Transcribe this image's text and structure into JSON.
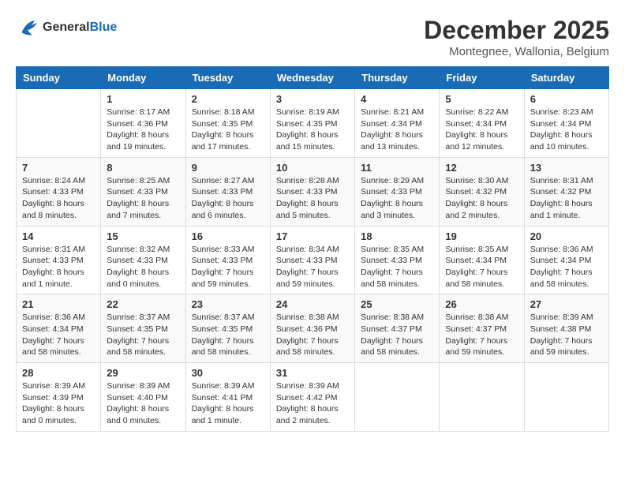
{
  "header": {
    "logo_line1": "General",
    "logo_line2": "Blue",
    "month_title": "December 2025",
    "location": "Montegnee, Wallonia, Belgium"
  },
  "days_of_week": [
    "Sunday",
    "Monday",
    "Tuesday",
    "Wednesday",
    "Thursday",
    "Friday",
    "Saturday"
  ],
  "weeks": [
    [
      {
        "day": "",
        "sunrise": "",
        "sunset": "",
        "daylight": ""
      },
      {
        "day": "1",
        "sunrise": "Sunrise: 8:17 AM",
        "sunset": "Sunset: 4:36 PM",
        "daylight": "Daylight: 8 hours and 19 minutes."
      },
      {
        "day": "2",
        "sunrise": "Sunrise: 8:18 AM",
        "sunset": "Sunset: 4:35 PM",
        "daylight": "Daylight: 8 hours and 17 minutes."
      },
      {
        "day": "3",
        "sunrise": "Sunrise: 8:19 AM",
        "sunset": "Sunset: 4:35 PM",
        "daylight": "Daylight: 8 hours and 15 minutes."
      },
      {
        "day": "4",
        "sunrise": "Sunrise: 8:21 AM",
        "sunset": "Sunset: 4:34 PM",
        "daylight": "Daylight: 8 hours and 13 minutes."
      },
      {
        "day": "5",
        "sunrise": "Sunrise: 8:22 AM",
        "sunset": "Sunset: 4:34 PM",
        "daylight": "Daylight: 8 hours and 12 minutes."
      },
      {
        "day": "6",
        "sunrise": "Sunrise: 8:23 AM",
        "sunset": "Sunset: 4:34 PM",
        "daylight": "Daylight: 8 hours and 10 minutes."
      }
    ],
    [
      {
        "day": "7",
        "sunrise": "Sunrise: 8:24 AM",
        "sunset": "Sunset: 4:33 PM",
        "daylight": "Daylight: 8 hours and 8 minutes."
      },
      {
        "day": "8",
        "sunrise": "Sunrise: 8:25 AM",
        "sunset": "Sunset: 4:33 PM",
        "daylight": "Daylight: 8 hours and 7 minutes."
      },
      {
        "day": "9",
        "sunrise": "Sunrise: 8:27 AM",
        "sunset": "Sunset: 4:33 PM",
        "daylight": "Daylight: 8 hours and 6 minutes."
      },
      {
        "day": "10",
        "sunrise": "Sunrise: 8:28 AM",
        "sunset": "Sunset: 4:33 PM",
        "daylight": "Daylight: 8 hours and 5 minutes."
      },
      {
        "day": "11",
        "sunrise": "Sunrise: 8:29 AM",
        "sunset": "Sunset: 4:33 PM",
        "daylight": "Daylight: 8 hours and 3 minutes."
      },
      {
        "day": "12",
        "sunrise": "Sunrise: 8:30 AM",
        "sunset": "Sunset: 4:32 PM",
        "daylight": "Daylight: 8 hours and 2 minutes."
      },
      {
        "day": "13",
        "sunrise": "Sunrise: 8:31 AM",
        "sunset": "Sunset: 4:32 PM",
        "daylight": "Daylight: 8 hours and 1 minute."
      }
    ],
    [
      {
        "day": "14",
        "sunrise": "Sunrise: 8:31 AM",
        "sunset": "Sunset: 4:33 PM",
        "daylight": "Daylight: 8 hours and 1 minute."
      },
      {
        "day": "15",
        "sunrise": "Sunrise: 8:32 AM",
        "sunset": "Sunset: 4:33 PM",
        "daylight": "Daylight: 8 hours and 0 minutes."
      },
      {
        "day": "16",
        "sunrise": "Sunrise: 8:33 AM",
        "sunset": "Sunset: 4:33 PM",
        "daylight": "Daylight: 7 hours and 59 minutes."
      },
      {
        "day": "17",
        "sunrise": "Sunrise: 8:34 AM",
        "sunset": "Sunset: 4:33 PM",
        "daylight": "Daylight: 7 hours and 59 minutes."
      },
      {
        "day": "18",
        "sunrise": "Sunrise: 8:35 AM",
        "sunset": "Sunset: 4:33 PM",
        "daylight": "Daylight: 7 hours and 58 minutes."
      },
      {
        "day": "19",
        "sunrise": "Sunrise: 8:35 AM",
        "sunset": "Sunset: 4:34 PM",
        "daylight": "Daylight: 7 hours and 58 minutes."
      },
      {
        "day": "20",
        "sunrise": "Sunrise: 8:36 AM",
        "sunset": "Sunset: 4:34 PM",
        "daylight": "Daylight: 7 hours and 58 minutes."
      }
    ],
    [
      {
        "day": "21",
        "sunrise": "Sunrise: 8:36 AM",
        "sunset": "Sunset: 4:34 PM",
        "daylight": "Daylight: 7 hours and 58 minutes."
      },
      {
        "day": "22",
        "sunrise": "Sunrise: 8:37 AM",
        "sunset": "Sunset: 4:35 PM",
        "daylight": "Daylight: 7 hours and 58 minutes."
      },
      {
        "day": "23",
        "sunrise": "Sunrise: 8:37 AM",
        "sunset": "Sunset: 4:35 PM",
        "daylight": "Daylight: 7 hours and 58 minutes."
      },
      {
        "day": "24",
        "sunrise": "Sunrise: 8:38 AM",
        "sunset": "Sunset: 4:36 PM",
        "daylight": "Daylight: 7 hours and 58 minutes."
      },
      {
        "day": "25",
        "sunrise": "Sunrise: 8:38 AM",
        "sunset": "Sunset: 4:37 PM",
        "daylight": "Daylight: 7 hours and 58 minutes."
      },
      {
        "day": "26",
        "sunrise": "Sunrise: 8:38 AM",
        "sunset": "Sunset: 4:37 PM",
        "daylight": "Daylight: 7 hours and 59 minutes."
      },
      {
        "day": "27",
        "sunrise": "Sunrise: 8:39 AM",
        "sunset": "Sunset: 4:38 PM",
        "daylight": "Daylight: 7 hours and 59 minutes."
      }
    ],
    [
      {
        "day": "28",
        "sunrise": "Sunrise: 8:39 AM",
        "sunset": "Sunset: 4:39 PM",
        "daylight": "Daylight: 8 hours and 0 minutes."
      },
      {
        "day": "29",
        "sunrise": "Sunrise: 8:39 AM",
        "sunset": "Sunset: 4:40 PM",
        "daylight": "Daylight: 8 hours and 0 minutes."
      },
      {
        "day": "30",
        "sunrise": "Sunrise: 8:39 AM",
        "sunset": "Sunset: 4:41 PM",
        "daylight": "Daylight: 8 hours and 1 minute."
      },
      {
        "day": "31",
        "sunrise": "Sunrise: 8:39 AM",
        "sunset": "Sunset: 4:42 PM",
        "daylight": "Daylight: 8 hours and 2 minutes."
      },
      {
        "day": "",
        "sunrise": "",
        "sunset": "",
        "daylight": ""
      },
      {
        "day": "",
        "sunrise": "",
        "sunset": "",
        "daylight": ""
      },
      {
        "day": "",
        "sunrise": "",
        "sunset": "",
        "daylight": ""
      }
    ]
  ]
}
